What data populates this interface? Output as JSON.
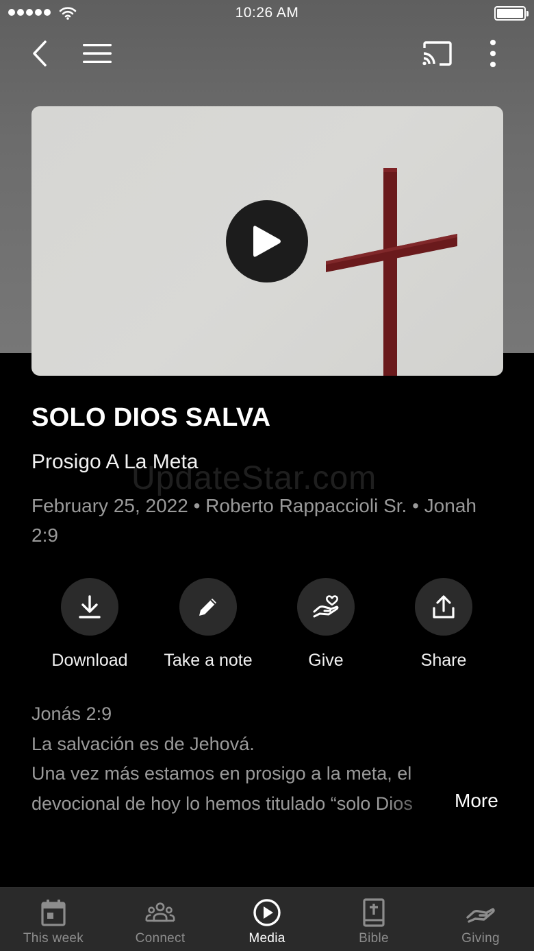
{
  "status_bar": {
    "time": "10:26 AM"
  },
  "video": {
    "play_icon": "play-icon"
  },
  "sermon": {
    "title": "SOLO DIOS SALVA",
    "series": "Prosigo A La Meta",
    "meta": "February 25, 2022 • Roberto Rappaccioli Sr. • Jonah 2:9"
  },
  "watermark": "UpdateStar.com",
  "actions": [
    {
      "label": "Download",
      "icon": "download-icon"
    },
    {
      "label": "Take a note",
      "icon": "pencil-icon"
    },
    {
      "label": "Give",
      "icon": "give-heart-hand-icon"
    },
    {
      "label": "Share",
      "icon": "share-icon"
    }
  ],
  "description": {
    "line1": "Jonás 2:9",
    "line2": "La salvación es de Jehová.",
    "line3": "Una vez más estamos en prosigo a la meta, el",
    "line4": "devocional de hoy lo hemos titulado “solo Dios",
    "more_label": "More"
  },
  "tabbar": {
    "active": "Media",
    "tabs": [
      {
        "label": "This week",
        "icon": "calendar-icon"
      },
      {
        "label": "Connect",
        "icon": "people-icon"
      },
      {
        "label": "Media",
        "icon": "play-circle-icon"
      },
      {
        "label": "Bible",
        "icon": "bible-icon"
      },
      {
        "label": "Giving",
        "icon": "giving-icon"
      }
    ]
  },
  "colors": {
    "background": "#000000",
    "tabbar": "#2a2a2a",
    "action_circle": "#2b2b2b",
    "muted_text": "#9a9a9a",
    "cross": "#6a1a1c"
  }
}
